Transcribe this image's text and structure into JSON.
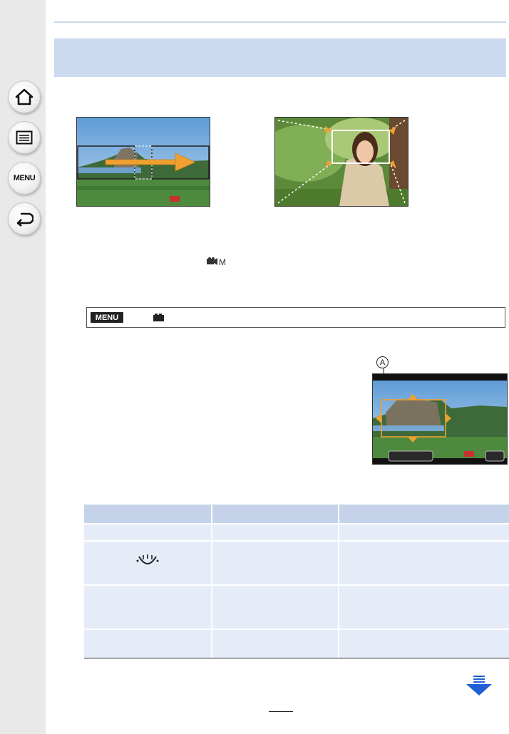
{
  "nav": {
    "home_icon": "home-icon",
    "toc_icon": "list-icon",
    "menu_label": "MENU",
    "back_icon": "return-arrow-icon"
  },
  "menu_path": {
    "badge": "MENU",
    "arrow": "→",
    "mode_icon": "motion-picture-icon"
  },
  "preview": {
    "marker": "A"
  },
  "table": {
    "row2_icon": "face-detection-icon"
  },
  "colors": {
    "title_band": "#ccdaf0",
    "table_header": "#c5d3ea",
    "table_cell": "#e6ecf7",
    "arrow_orange": "#f0a030",
    "next_arrow_blue": "#1f5fd6"
  }
}
